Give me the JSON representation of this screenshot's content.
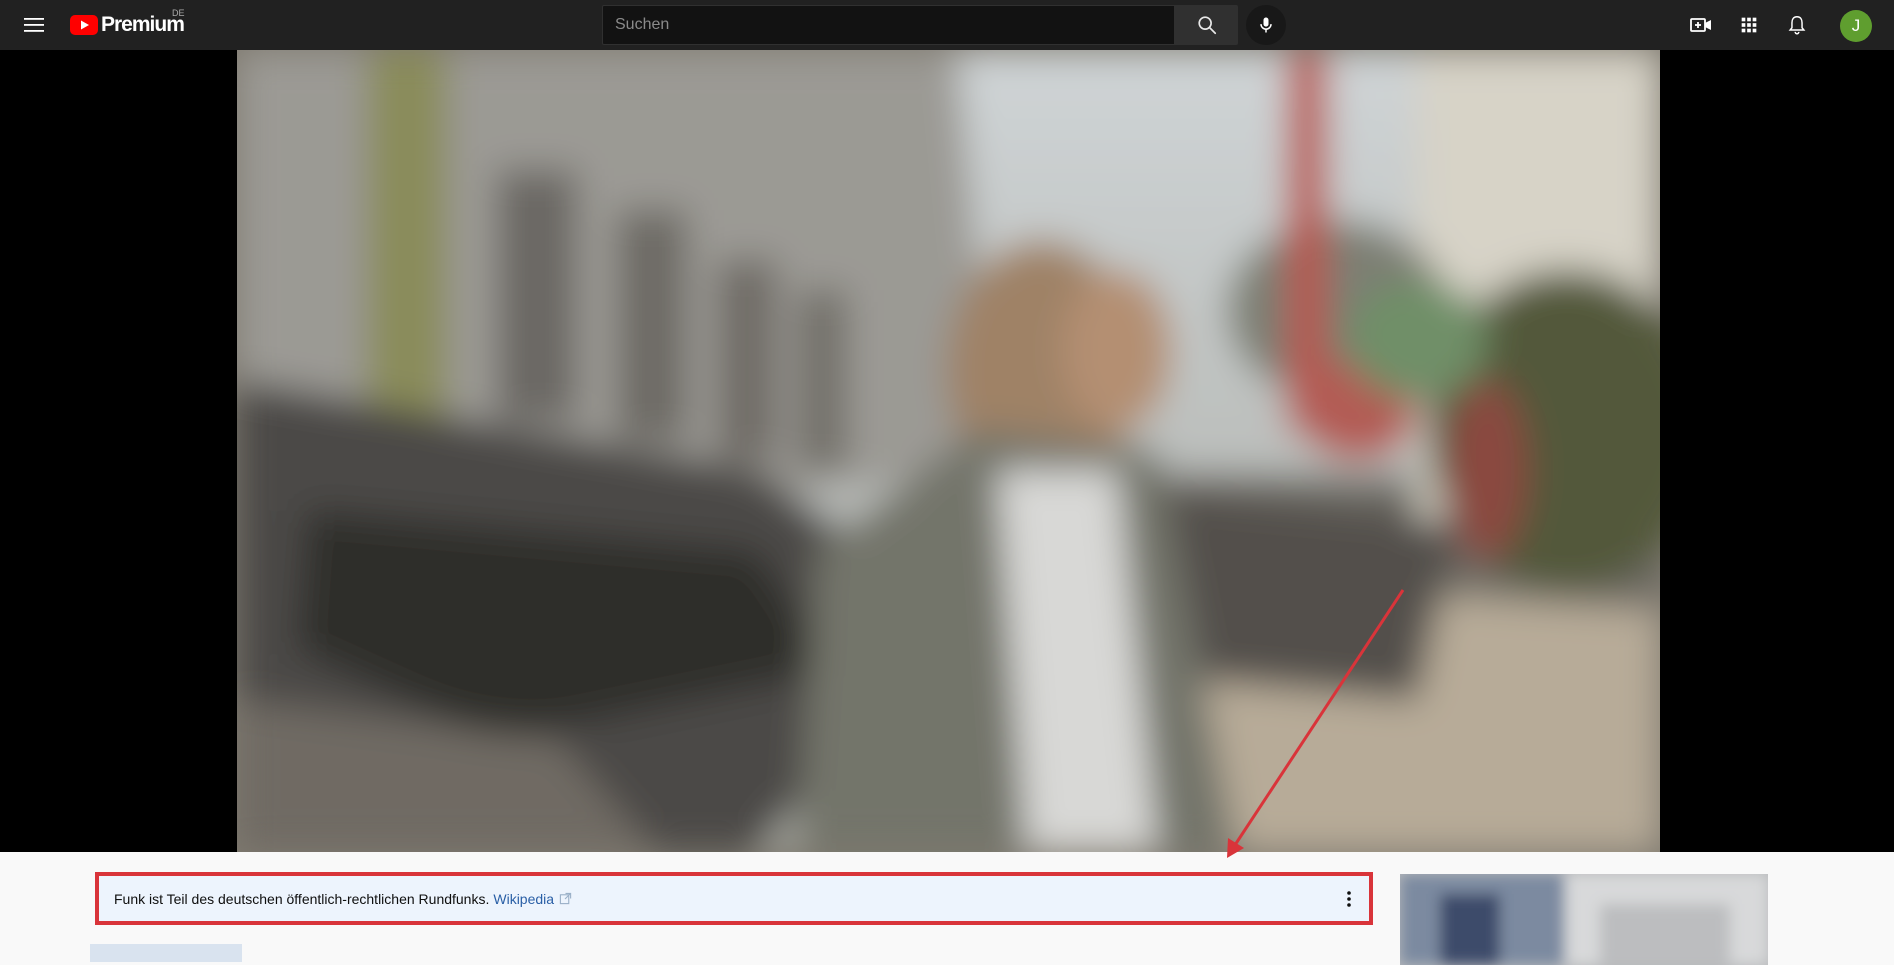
{
  "header": {
    "logo_text": "Premium",
    "logo_country": "DE",
    "search_placeholder": "Suchen",
    "avatar_initial": "J",
    "icons": [
      "menu-icon",
      "youtube-logo-icon",
      "search-icon",
      "microphone-icon",
      "create-video-icon",
      "apps-grid-icon",
      "notifications-bell-icon"
    ]
  },
  "info_panel": {
    "text": "Funk ist Teil des deutschen öffentlich-rechtlichen Rundfunks.",
    "link_label": "Wikipedia",
    "icons": [
      "external-link-icon",
      "more-options-icon"
    ]
  },
  "colors": {
    "brand_red": "#ff0000",
    "annotation_red": "#d9343a",
    "link_blue": "#2a5fa6",
    "avatar_green": "#5f9e2f"
  }
}
